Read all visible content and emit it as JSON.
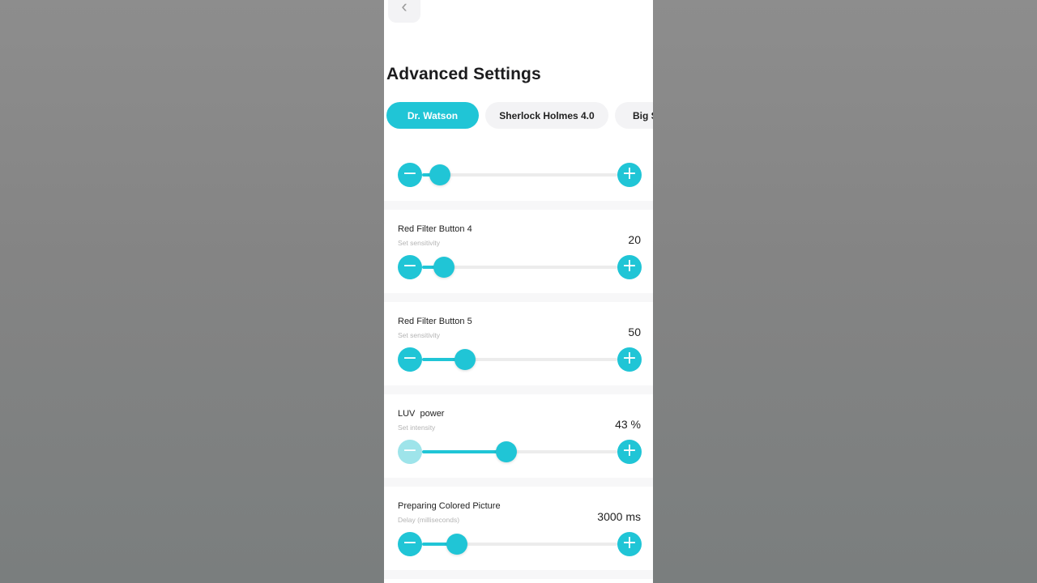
{
  "header": {
    "back_icon": "chevron-left-icon",
    "title": "Advanced Settings"
  },
  "tabs": [
    {
      "label": "Dr. Watson",
      "active": true
    },
    {
      "label": "Sherlock Holmes 4.0",
      "active": false
    },
    {
      "label": "Big S",
      "active": false
    }
  ],
  "colors": {
    "accent": "#20c5d6",
    "accent_disabled": "#9ee4ea",
    "track": "#ececec"
  },
  "settings": [
    {
      "title": "",
      "subtitle": "",
      "value": "",
      "level": 0.09
    },
    {
      "title": "Red Filter Button 4",
      "subtitle": "Set sensitivity",
      "value": "20",
      "level": 0.11
    },
    {
      "title": "Red Filter Button 5",
      "subtitle": "Set sensitivity",
      "value": "50",
      "level": 0.22
    },
    {
      "title": "LUV  power",
      "subtitle": "Set intensity",
      "value": "43 %",
      "level": 0.43,
      "minus_disabled": true
    },
    {
      "title": "Preparing Colored Picture",
      "subtitle": "Delay (milliseconds)",
      "value": "3000 ms",
      "level": 0.18
    }
  ],
  "icons": {
    "minus": "minus-icon",
    "plus": "plus-icon"
  }
}
